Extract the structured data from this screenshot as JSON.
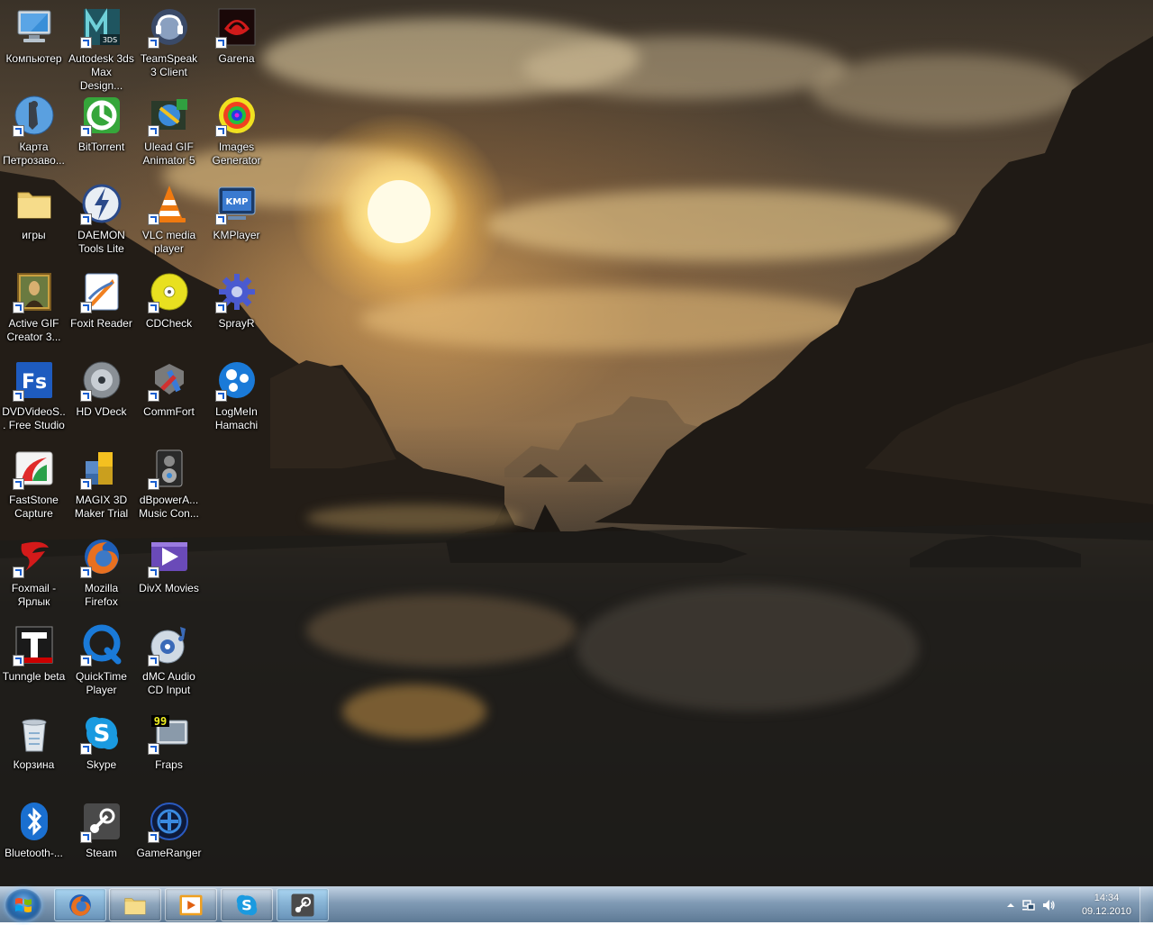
{
  "desktop": {
    "columns": [
      [
        {
          "label": "Компьютер",
          "icon": "computer-icon",
          "shortcut": false
        },
        {
          "label": "Карта Петрозаво...",
          "icon": "map-icon",
          "shortcut": true
        },
        {
          "label": "игры",
          "icon": "folder-icon",
          "shortcut": false
        },
        {
          "label": "Active GIF Creator 3...",
          "icon": "mona-lisa-icon",
          "shortcut": true
        },
        {
          "label": "DVDVideoS... Free Studio",
          "icon": "fs-icon",
          "shortcut": true
        },
        {
          "label": "FastStone Capture",
          "icon": "faststone-icon",
          "shortcut": true
        },
        {
          "label": "Foxmail - Ярлык",
          "icon": "foxmail-icon",
          "shortcut": true
        },
        {
          "label": "Tunngle beta",
          "icon": "tunngle-icon",
          "shortcut": true
        },
        {
          "label": "Корзина",
          "icon": "recycle-bin-icon",
          "shortcut": false
        },
        {
          "label": "Bluetooth-...",
          "icon": "bluetooth-icon",
          "shortcut": false
        }
      ],
      [
        {
          "label": "Autodesk 3ds Max Design...",
          "icon": "3ds-max-icon",
          "shortcut": true
        },
        {
          "label": "BitTorrent",
          "icon": "bittorrent-icon",
          "shortcut": true
        },
        {
          "label": "DAEMON Tools Lite",
          "icon": "daemon-tools-icon",
          "shortcut": true
        },
        {
          "label": "Foxit Reader",
          "icon": "foxit-reader-icon",
          "shortcut": true
        },
        {
          "label": "HD VDeck",
          "icon": "hd-vdeck-icon",
          "shortcut": true
        },
        {
          "label": "MAGIX 3D Maker Trial",
          "icon": "magix-3d-icon",
          "shortcut": true
        },
        {
          "label": "Mozilla Firefox",
          "icon": "firefox-icon",
          "shortcut": true
        },
        {
          "label": "QuickTime Player",
          "icon": "quicktime-icon",
          "shortcut": true
        },
        {
          "label": "Skype",
          "icon": "skype-icon",
          "shortcut": true
        },
        {
          "label": "Steam",
          "icon": "steam-icon",
          "shortcut": true
        }
      ],
      [
        {
          "label": "TeamSpeak 3 Client",
          "icon": "teamspeak-icon",
          "shortcut": true
        },
        {
          "label": "Ulead GIF Animator 5",
          "icon": "ulead-gif-icon",
          "shortcut": true
        },
        {
          "label": "VLC media player",
          "icon": "vlc-icon",
          "shortcut": true
        },
        {
          "label": "CDCheck",
          "icon": "cdcheck-icon",
          "shortcut": true
        },
        {
          "label": "CommFort",
          "icon": "commfort-icon",
          "shortcut": true
        },
        {
          "label": "dBpowerA... Music Con...",
          "icon": "dbpoweramp-icon",
          "shortcut": true
        },
        {
          "label": "DivX Movies",
          "icon": "divx-icon",
          "shortcut": true
        },
        {
          "label": "dMC Audio CD Input",
          "icon": "dmc-audio-icon",
          "shortcut": true
        },
        {
          "label": "Fraps",
          "icon": "fraps-icon",
          "shortcut": true
        },
        {
          "label": "GameRanger",
          "icon": "gameranger-icon",
          "shortcut": true
        }
      ],
      [
        {
          "label": "Garena",
          "icon": "garena-icon",
          "shortcut": true
        },
        {
          "label": "Images Generator",
          "icon": "images-generator-icon",
          "shortcut": true
        },
        {
          "label": "KMPlayer",
          "icon": "kmplayer-icon",
          "shortcut": true
        },
        {
          "label": "SprayR",
          "icon": "sprayr-icon",
          "shortcut": true
        },
        {
          "label": "LogMeIn Hamachi",
          "icon": "hamachi-icon",
          "shortcut": true
        }
      ]
    ]
  },
  "taskbar": {
    "pinned": [
      {
        "name": "firefox",
        "icon": "firefox-icon",
        "active": true
      },
      {
        "name": "explorer",
        "icon": "folder-icon",
        "active": false
      },
      {
        "name": "media-player",
        "icon": "media-player-icon",
        "active": false
      },
      {
        "name": "skype",
        "icon": "skype-icon",
        "active": false
      },
      {
        "name": "steam",
        "icon": "steam-icon",
        "active": true
      }
    ],
    "clock": {
      "time": "14:34",
      "date": "09.12.2010"
    }
  },
  "colors": {
    "taskbar": "#6e8caa",
    "label_text": "#ffffff",
    "shortcut_arrow": "#1a5fd0"
  }
}
